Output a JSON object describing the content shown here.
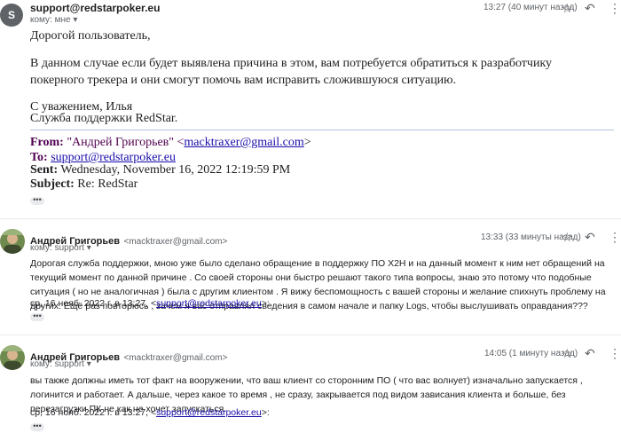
{
  "message1": {
    "avatar_letter": "S",
    "sender": "support@redstarpoker.eu",
    "to": "кому: мне",
    "time": "13:27 (40 минут назад)",
    "greeting": "Дорогой пользователь,",
    "paragraph": "В данном случае если будет выявлена причина в этом, вам потребуется обратиться к разработчику покерного трекера и они смогут помочь вам исправить сложившуюся ситуацию.",
    "sign1": "С уважением, Илья",
    "sign2": "Служба поддержки RedStar.",
    "quoted": {
      "from_label": "From:",
      "from_value": "\"Андрей Григорьев\" <",
      "from_email": "macktraxer@gmail.com",
      "from_close": ">",
      "to_label": "To:",
      "to_value": "support@redstarpoker.eu",
      "sent_label": "Sent:",
      "sent_value": "Wednesday, November 16, 2022 12:19:59 PM",
      "subject_label": "Subject:",
      "subject_value": "Re: RedStar"
    },
    "more": "•••"
  },
  "message2": {
    "sender": "Андрей Григорьев",
    "sender_email": "<macktraxer@gmail.com>",
    "to": "кому: support",
    "time": "13:33 (33 минуты назад)",
    "body": "Дорогая служба поддержки, мною уже было сделано обращение в поддержку ПО Х2Н и на данный момент к ним нет обращений на текущий момент по данной причине . Со своей стороны они быстро решают такого типа вопросы, знаю это потому что подобные ситуация ( но не аналогичная ) была с другим клиентом . Я вижу беспомощность с вашей стороны и желание спихнуть проблему на других. Ещё раз повторюсь , зачем я вас отправлял сведения в самом начале и папку Logs, чтобы выслушивать оправдания???",
    "quote_prefix": "ср, 16 нояб. 2022 г. в 13:27, <",
    "quote_email": "support@redstarpoker.eu",
    "quote_suffix": ">:",
    "more": "•••"
  },
  "message3": {
    "sender": "Андрей Григорьев",
    "sender_email": "<macktraxer@gmail.com>",
    "to": "кому: support",
    "time": "14:05 (1 минуту назад)",
    "body": "вы также должны иметь тот факт на вооружении, что ваш клиент со сторонним ПО ( что вас волнует) изначально запускается , логинится и работает. А дальше, через какое то время , не сразу, закрывается под видом зависания клиента и больше, без перезагрузки ПК не как не хочет запускаться.",
    "quote_prefix": "ср, 16 нояб. 2022 г. в 13:27, <",
    "quote_email": "support@redstarpoker.eu",
    "quote_suffix": ">:",
    "more": "•••"
  },
  "icons": {
    "star": "☆",
    "reply": "↶",
    "more_vert": "⋮",
    "dropdown": "▾"
  },
  "colors": {
    "avatar_s": "#5f6368",
    "quoted_label": "#500050",
    "link": "#1a0dab"
  }
}
